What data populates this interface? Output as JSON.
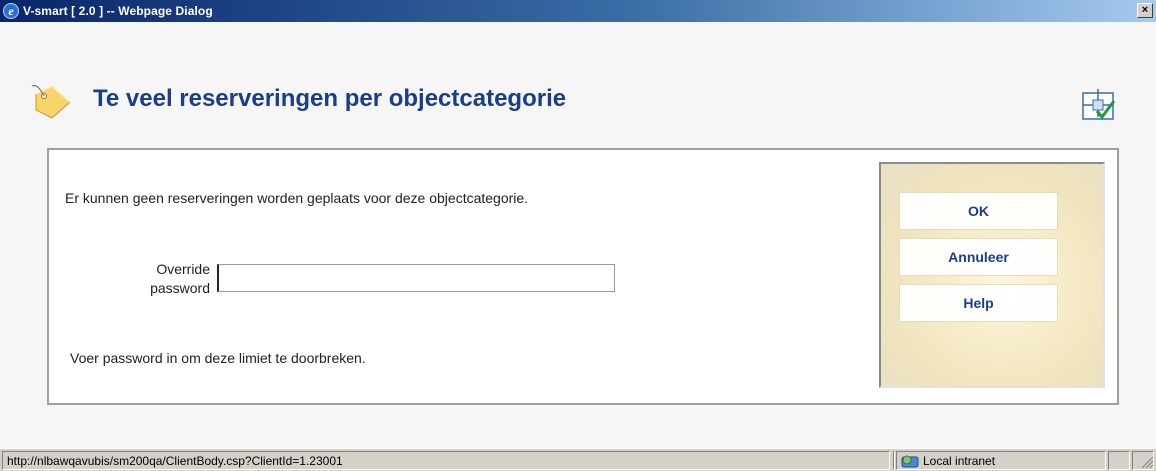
{
  "window": {
    "title": "V-smart [ 2.0 ] -- Webpage Dialog",
    "close_glyph": "×"
  },
  "header": {
    "title": "Te veel reserveringen per objectcategorie",
    "title_color": "#1b3d8f",
    "left_icon": "tag-icon",
    "right_icon": "confirm-layout-icon"
  },
  "panel": {
    "message": "Er kunnen geen reserveringen worden geplaats voor deze objectcategorie.",
    "field": {
      "label_line1": "Override",
      "label_line2": "password",
      "value": ""
    },
    "hint": "Voer password in om deze limiet te doorbreken."
  },
  "buttons": {
    "ok": "OK",
    "cancel": "Annuleer",
    "help": "Help"
  },
  "statusbar": {
    "url": "http://nlbawqavubis/sm200qa/ClientBody.csp?ClientId=1.23001",
    "zone": "Local intranet",
    "zone_icon": "globe-icon"
  }
}
